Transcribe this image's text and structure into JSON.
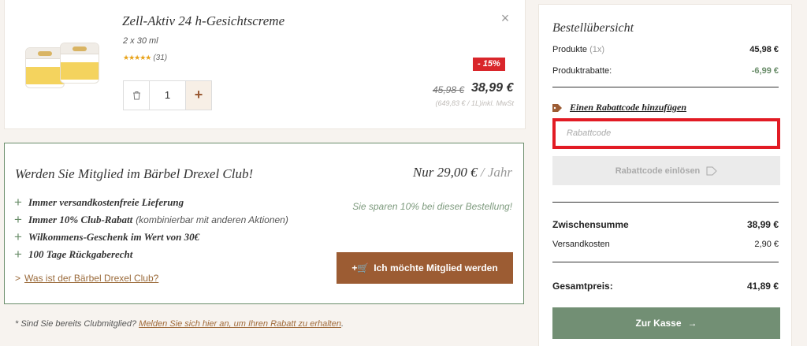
{
  "product": {
    "title": "Zell-Aktiv 24 h-Gesichtscreme",
    "size": "2 x 30 ml",
    "stars": "★★★★★",
    "rating_count": "(31)",
    "discount_badge": "- 15%",
    "quantity": "1",
    "old_price": "45,98 €",
    "new_price": "38,99 €",
    "unit_price": "(649,83 € / 1L)inkl. MwSt",
    "close_glyph": "×",
    "plus_glyph": "+"
  },
  "club": {
    "title": "Werden Sie Mitglied im Bärbel Drexel Club!",
    "price": "Nur 29,00 €",
    "per": "/ Jahr",
    "benefits": [
      {
        "text": "Immer versandkostenfreie Lieferung",
        "extra": ""
      },
      {
        "text": "Immer 10% Club-Rabatt",
        "extra": "(kombinierbar mit anderen Aktionen)"
      },
      {
        "text": "Wilkommens-Geschenk im Wert von 30€",
        "extra": ""
      },
      {
        "text": "100 Tage Rückgaberecht",
        "extra": ""
      }
    ],
    "savings": "Sie sparen 10% bei dieser Bestellung!",
    "link_chevron": ">",
    "link_text": "Was ist der Bärbel Drexel Club?",
    "button_label": "Ich möchte Mitglied werden",
    "button_icon": "+🛒"
  },
  "footer": {
    "prefix": "* Sind Sie bereits Clubmitglied?",
    "link": "Melden Sie sich hier an, um Ihren Rabatt zu erhalten",
    "suffix": "."
  },
  "summary": {
    "title": "Bestellübersicht",
    "products_label": "Produkte",
    "products_count": "(1x)",
    "products_amount": "45,98 €",
    "discount_label": "Produktrabatte:",
    "discount_amount": "-6,99 €",
    "coupon_link": "Einen Rabattcode hinzufügen",
    "coupon_placeholder": "Rabattcode",
    "coupon_button": "Rabattcode einlösen",
    "subtotal_label": "Zwischensumme",
    "subtotal_amount": "38,99 €",
    "shipping_label": "Versandkosten",
    "shipping_amount": "2,90 €",
    "total_label": "Gesamtpreis:",
    "total_amount": "41,89 €",
    "checkout_label": "Zur Kasse",
    "checkout_arrow": "→"
  },
  "colors": {
    "accent_brown": "#9c5c33",
    "accent_green": "#728f74",
    "badge_red": "#d9262b",
    "highlight_red": "#e21b24"
  }
}
